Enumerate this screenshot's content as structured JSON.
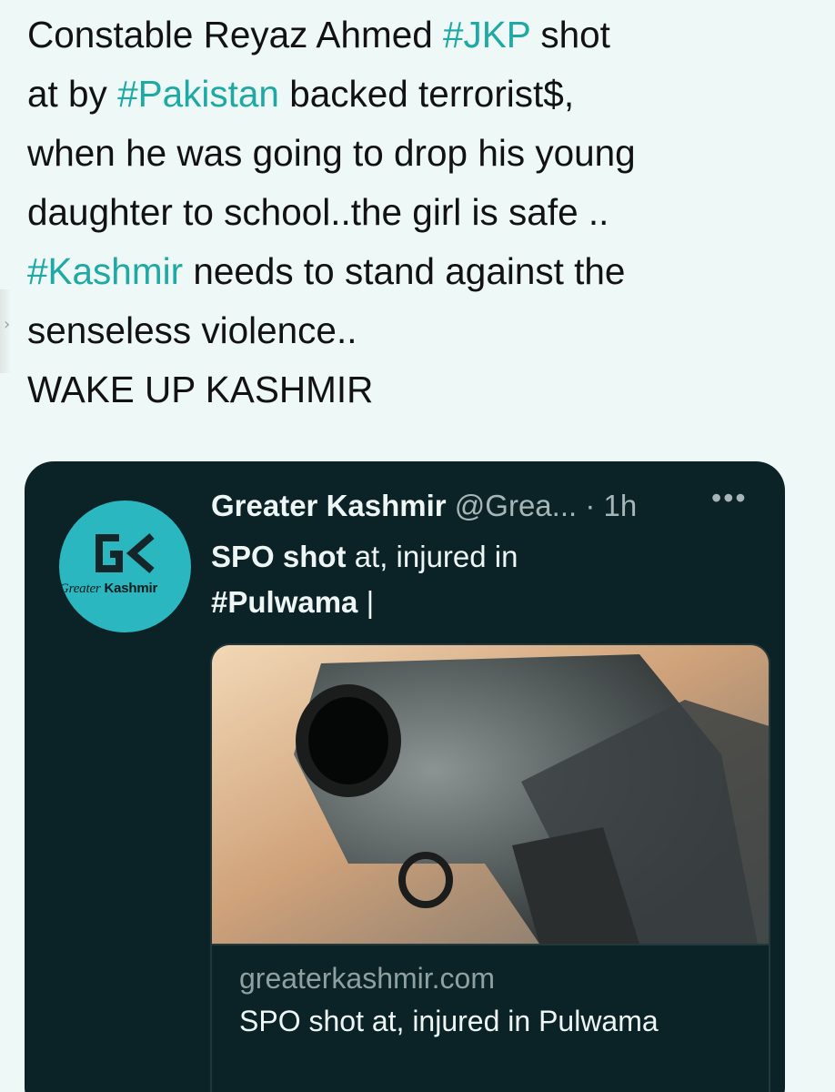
{
  "tweet": {
    "lines": [
      [
        {
          "t": "Constable Reyaz Ahmed ",
          "h": false
        },
        {
          "t": "#JKP",
          "h": true
        },
        {
          "t": "  shot",
          "h": false
        }
      ],
      [
        {
          "t": "at by ",
          "h": false
        },
        {
          "t": "#Pakistan",
          "h": true
        },
        {
          "t": " backed terrorist$,",
          "h": false
        }
      ],
      [
        {
          "t": "when he was going to drop his young",
          "h": false
        }
      ],
      [
        {
          "t": "daughter to school..the girl is safe ..",
          "h": false
        }
      ],
      [
        {
          "t": "#Kashmir",
          "h": true
        },
        {
          "t": " needs to stand against the",
          "h": false
        }
      ],
      [
        {
          "t": "senseless violence..",
          "h": false
        }
      ],
      [
        {
          "t": "WAKE UP KASHMIR",
          "h": false
        }
      ]
    ]
  },
  "quoted": {
    "author_name": "Greater Kashmir",
    "handle": "@Grea...",
    "time": "· 1h",
    "more_icon": "•••",
    "avatar": {
      "logo_text": "GK",
      "word_italic": "Greater",
      "word_bold": "Kashmir"
    },
    "text_bold_1": "SPO shot",
    "text_plain_1": " at, injured in",
    "text_bold_2": "#Pulwama",
    "text_plain_2": " |",
    "link": {
      "domain": "greaterkashmir.com",
      "title": "SPO shot at, injured in Pulwama"
    }
  },
  "colors": {
    "hashtag": "#1ea9a5",
    "card_bg": "#0b2226",
    "avatar_bg": "#2ab7bf"
  }
}
